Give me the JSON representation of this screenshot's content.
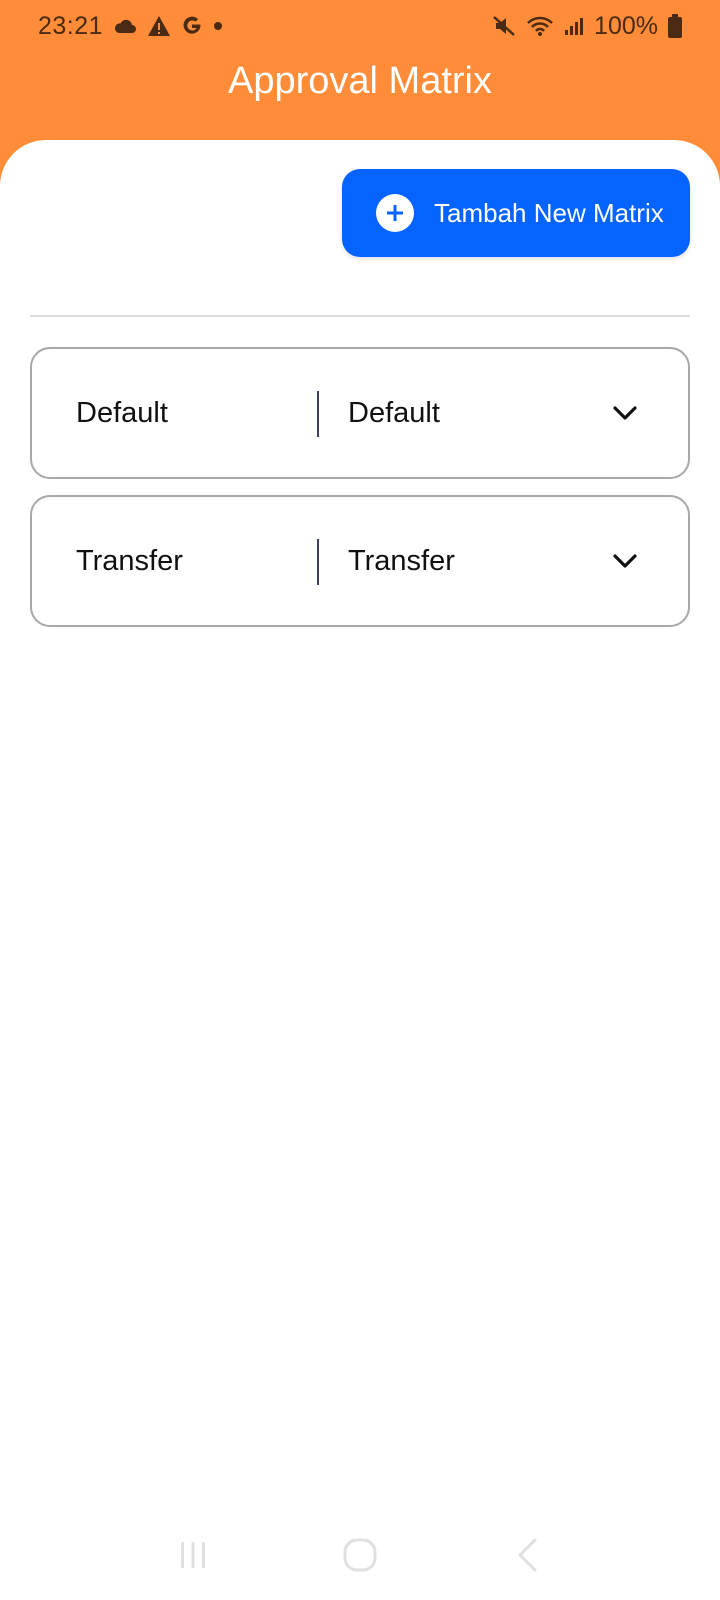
{
  "status_bar": {
    "time": "23:21",
    "battery": "100%",
    "icons_left": [
      "cloud-icon",
      "warning-icon",
      "google-icon",
      "dot-icon"
    ],
    "icons_right": [
      "mute-icon",
      "wifi-icon",
      "signal-icon",
      "battery-icon"
    ]
  },
  "header": {
    "title": "Approval Matrix",
    "color": "#ff8c38"
  },
  "actions": {
    "add_label": "Tambah New Matrix",
    "accent": "#0564ff"
  },
  "matrices": [
    {
      "name": "Default",
      "value": "Default"
    },
    {
      "name": "Transfer",
      "value": "Transfer"
    }
  ],
  "navigation": {
    "buttons": [
      "recents-icon",
      "home-icon",
      "back-icon"
    ]
  }
}
